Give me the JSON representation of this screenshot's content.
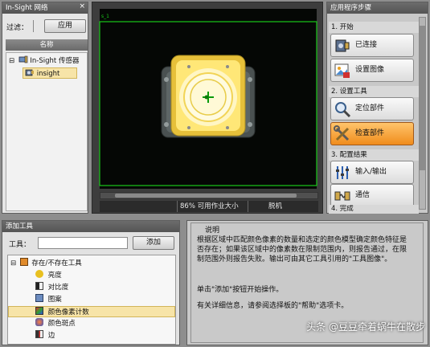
{
  "network_panel": {
    "title": "In-Sight 网络",
    "close": "×",
    "filter_label": "过滤：",
    "apply_label": "应用",
    "column_header": "名称",
    "tree": [
      {
        "expander": "⊟",
        "label": "In-Sight 传感器"
      },
      {
        "label": "insight",
        "selected": true
      }
    ]
  },
  "camera_view": {
    "frame_label": "s_1",
    "status": {
      "zoom": "86% 可用作业大小",
      "mode": "脱机"
    },
    "accent": "#19c819"
  },
  "steps_panel": {
    "title": "应用程序步骤",
    "sections": [
      {
        "label": "1. 开始",
        "buttons": [
          {
            "label": "已连接",
            "icon": "connected-icon"
          },
          {
            "label": "设置图像",
            "icon": "image-setup-icon"
          }
        ]
      },
      {
        "label": "2. 设置工具",
        "buttons": [
          {
            "label": "定位部件",
            "icon": "magnifier-icon"
          },
          {
            "label": "检查部件",
            "icon": "tools-icon",
            "active": true
          }
        ]
      },
      {
        "label": "3. 配置结果",
        "buttons": [
          {
            "label": "输入/输出",
            "icon": "io-icon"
          },
          {
            "label": "通信",
            "icon": "communication-icon"
          }
        ]
      },
      {
        "label": "4. 完成",
        "buttons": []
      }
    ]
  },
  "add_tool_panel": {
    "title": "添加工具",
    "tool_label": "工具：",
    "tool_input_value": "",
    "add_label": "添加",
    "tree": [
      {
        "expander": "⊟",
        "label": "存在/不存在工具"
      },
      {
        "label": "亮度"
      },
      {
        "label": "对比度"
      },
      {
        "label": "图案"
      },
      {
        "label": "颜色像素计数",
        "selected": true
      },
      {
        "label": "颜色斑点"
      },
      {
        "label": "边"
      }
    ]
  },
  "description_panel": {
    "header": "说明",
    "paragraphs": [
      "根据区域中匹配颜色像素的数量和选定的颜色模型确定颜色特征是否存在；如果该区域中的像素数在限制范围内，则报告通过，在限制范围外则报告失败。输出可由其它工具引用的\"工具图像\"。",
      "单击\"添加\"按钮开始操作。",
      "有关详细信息，请参阅选择板的\"帮助\"选项卡。"
    ]
  },
  "watermark": "头条 @豆豆牵着蜗牛在散步"
}
